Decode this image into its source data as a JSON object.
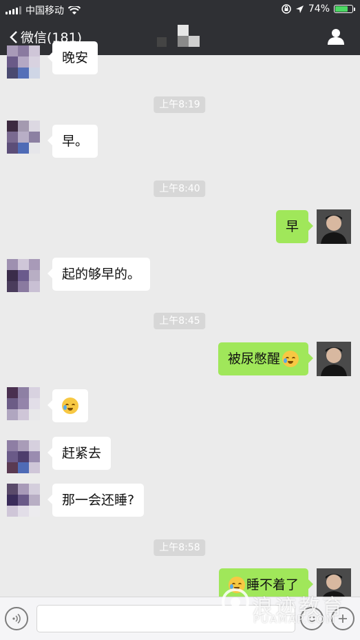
{
  "status_bar": {
    "carrier": "中国移动",
    "battery_percent": "74%",
    "battery_level": 0.74
  },
  "nav": {
    "back_label": "微信(181)"
  },
  "messages": [
    {
      "type": "in",
      "text": "晚安"
    },
    {
      "type": "time",
      "text": "上午8:19"
    },
    {
      "type": "in",
      "text": "早。"
    },
    {
      "type": "time",
      "text": "上午8:40"
    },
    {
      "type": "out",
      "text": "早"
    },
    {
      "type": "in",
      "text": "起的够早的。"
    },
    {
      "type": "time",
      "text": "上午8:45"
    },
    {
      "type": "out",
      "text": "被尿憋醒",
      "emoji": "crying-laughing-emoji"
    },
    {
      "type": "in",
      "text": "",
      "emoji": "crying-laughing-emoji"
    },
    {
      "type": "in",
      "text": "赶紧去"
    },
    {
      "type": "in",
      "text": "那一会还睡?"
    },
    {
      "type": "time",
      "text": "上午8:58"
    },
    {
      "type": "out",
      "text": "睡不着了",
      "emoji": "crying-laughing-emoji"
    }
  ],
  "input_bar": {
    "voice_icon": "voice-icon",
    "emoji_icon": "smiley-icon",
    "more_icon": "plus-icon"
  },
  "watermark": {
    "text_cn": "浪迹教育",
    "text_en": "PUAMAP.COM"
  },
  "colors": {
    "nav_bg": "#2f3034",
    "chat_bg": "#ebebeb",
    "outgoing_bubble": "#a0e75a",
    "incoming_bubble": "#ffffff",
    "timestamp_bg": "#d7d7d7"
  }
}
